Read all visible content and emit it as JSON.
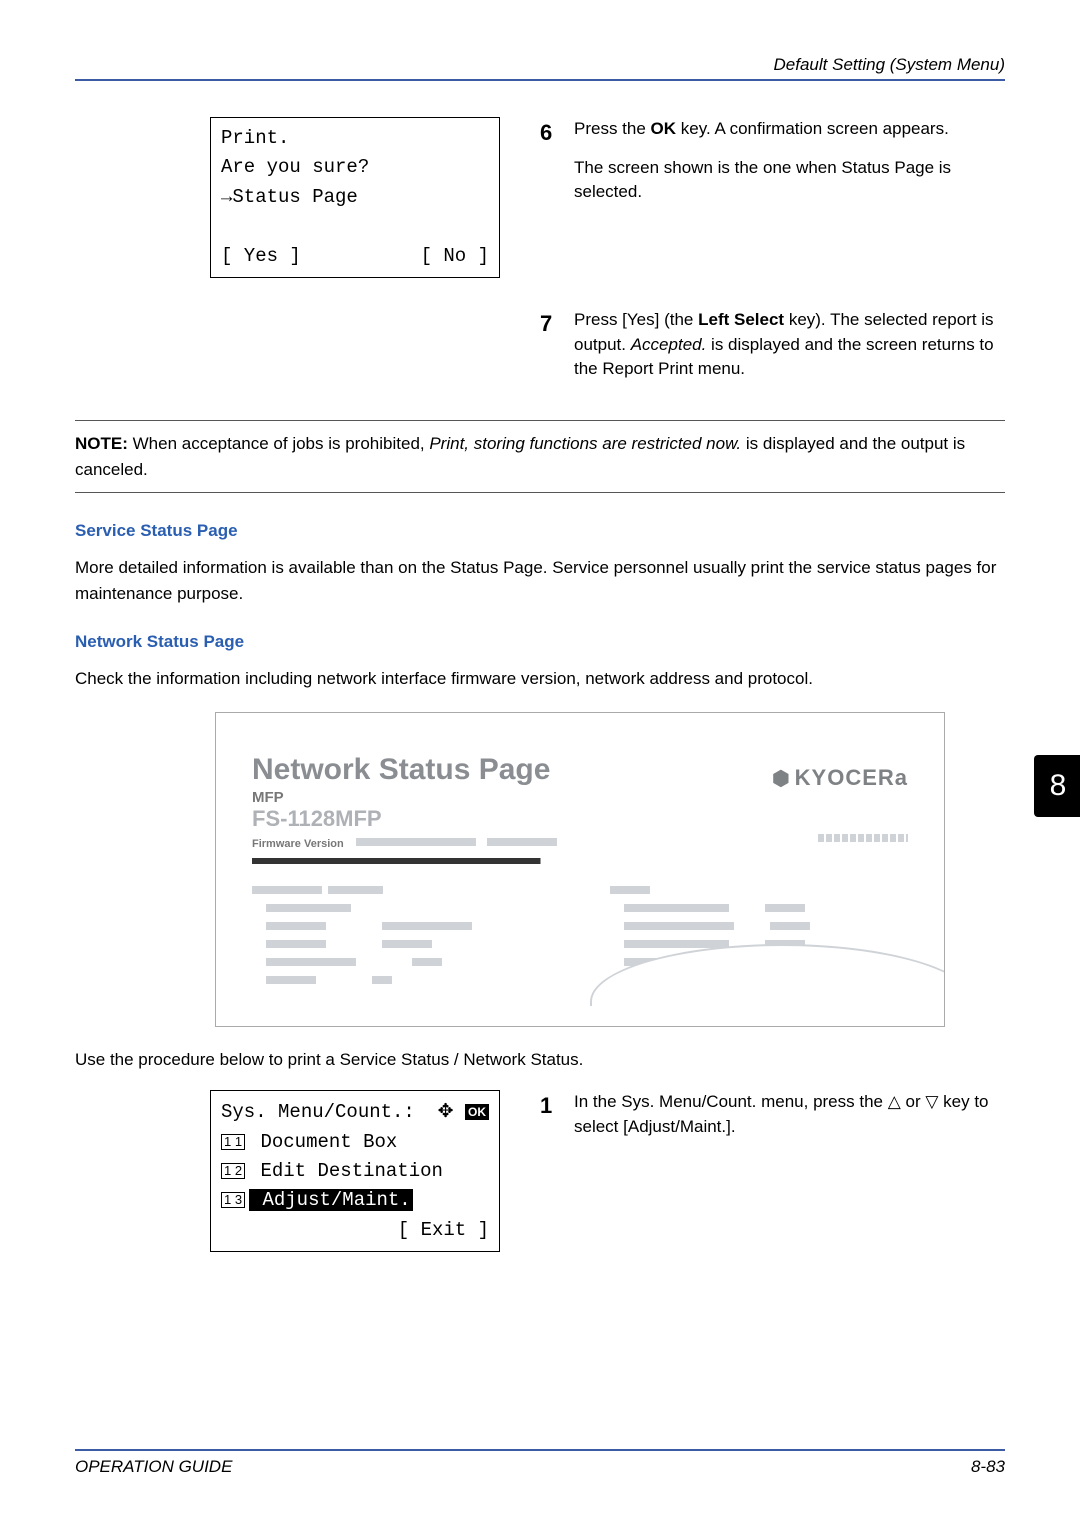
{
  "header": "Default Setting (System Menu)",
  "lcd1": {
    "line1": "Print.",
    "line2": "Are you sure?",
    "line3": "→Status Page",
    "yes": "[  Yes  ]",
    "no": "[  No   ]"
  },
  "step6": {
    "num": "6",
    "text1a": "Press the ",
    "text1b": "OK",
    "text1c": " key. A confirmation screen appears.",
    "text2": "The screen shown is the one when Status Page is selected."
  },
  "step7": {
    "num": "7",
    "text_a": "Press [Yes] (the ",
    "text_b": "Left Select",
    "text_c": " key). The selected report is output. ",
    "text_d": "Accepted.",
    "text_e": " is displayed and the screen returns to the Report Print menu."
  },
  "note": {
    "label": "NOTE:",
    "text_a": " When acceptance of jobs is prohibited, ",
    "text_b": "Print, storing functions are restricted now.",
    "text_c": " is displayed and the output is canceled."
  },
  "service_head": "Service Status Page",
  "service_text": "More detailed information is available than on the Status Page. Service personnel usually print the service status pages for maintenance purpose.",
  "network_head": "Network Status Page",
  "network_text": "Check the information including network interface firmware version, network address and protocol.",
  "figure": {
    "title": "Network Status Page",
    "sub1": "MFP",
    "sub2": "FS-1128MFP",
    "fw": "Firmware Version",
    "logo": "KYOCERa"
  },
  "use_text": "Use the procedure below to print a Service Status / Network Status.",
  "lcd2": {
    "title": "Sys. Menu/Count.:",
    "ok": "OK",
    "item11_num": "1 1",
    "item11": " Document Box",
    "item12_num": "1 2",
    "item12": " Edit Destination",
    "item13_num": "1 3",
    "item13": " Adjust/Maint.",
    "exit": "[  Exit  ]"
  },
  "step1": {
    "num": "1",
    "text": "In the Sys. Menu/Count. menu, press the △ or ▽ key to select [Adjust/Maint.]."
  },
  "sidetab": "8",
  "footer_left": "OPERATION GUIDE",
  "footer_right": "8-83"
}
